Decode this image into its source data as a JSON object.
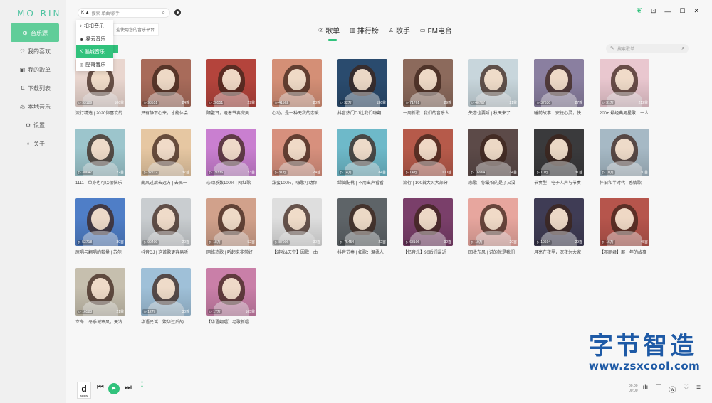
{
  "app": {
    "logo": "MO RIN"
  },
  "colors": {
    "accent": "#31c27c",
    "watermark": "#1e5aa6"
  },
  "sidebar": {
    "items": [
      {
        "icon": "music-source-icon",
        "glyph": "⊕",
        "label": "音乐源",
        "active": true
      },
      {
        "icon": "heart-icon",
        "glyph": "♡",
        "label": "我的喜欢"
      },
      {
        "icon": "playlist-icon",
        "glyph": "▣",
        "label": "我的歌单"
      },
      {
        "icon": "download-icon",
        "glyph": "⇅",
        "label": "下载列表"
      },
      {
        "icon": "local-music-icon",
        "glyph": "◎",
        "label": "本地音乐"
      },
      {
        "icon": "settings-icon",
        "glyph": "⚙",
        "label": "设置"
      },
      {
        "icon": "info-icon",
        "glyph": "♀",
        "label": "关于"
      }
    ]
  },
  "search": {
    "source_badge": "K ▲",
    "placeholder": "搜索 单曲/歌手"
  },
  "dropdown": {
    "items": [
      {
        "glyph": "♪",
        "label": "扣扣音乐"
      },
      {
        "glyph": "◉",
        "label": "易云音乐"
      },
      {
        "glyph": "K",
        "label": "酷城音乐",
        "selected": true
      },
      {
        "glyph": "◎",
        "label": "酷哥音乐"
      }
    ],
    "hint": "迎使用您的音乐平台"
  },
  "tabs": [
    {
      "glyph": "②",
      "label": "歌单",
      "active": true
    },
    {
      "glyph": "▥",
      "label": "排行榜"
    },
    {
      "glyph": "♙",
      "label": "歌手"
    },
    {
      "glyph": "▭",
      "label": "FM电台"
    }
  ],
  "list_search": {
    "placeholder": "搜索歌单"
  },
  "playlists": [
    {
      "plays": "93189",
      "songs": "106首",
      "title": "流行精选 | 2020你喜欢的",
      "bg": "#e9d6cf"
    },
    {
      "plays": "93551",
      "songs": "24首",
      "title": "只有静下心来，才能体会",
      "bg": "#a86b5a"
    },
    {
      "plays": "20551",
      "songs": "29首",
      "title": "隔壁耳，退着节奏完美",
      "bg": "#b4443c"
    },
    {
      "plays": "41562",
      "songs": "20首",
      "title": "心动，是一种无我的恋爱",
      "bg": "#d48f76"
    },
    {
      "plays": "32万",
      "songs": "136首",
      "title": "抖音热门DJ让我们嗨翻",
      "bg": "#2a4b6e"
    },
    {
      "plays": "71761",
      "songs": "29首",
      "title": "一周新歌 | 我们的音乐人",
      "bg": "#8c6a5c"
    },
    {
      "plays": "48767",
      "songs": "21首",
      "title": "失恋也要听 | 秋天来了",
      "bg": "#c8d6dc"
    },
    {
      "plays": "37330",
      "songs": "27首",
      "title": "睡前故事：安抚心灵，快",
      "bg": "#8a7fa0"
    },
    {
      "plays": "31万",
      "songs": "212首",
      "title": "200+ 最经典男星歌：一人",
      "bg": "#e9c7cf"
    },
    {
      "plays": "30647",
      "songs": "22首",
      "title": "1111 · 单身也可以很快乐",
      "bg": "#9cc5cc"
    },
    {
      "plays": "32212",
      "songs": "37首",
      "title": "南风过后去远方 | 去民一",
      "bg": "#e6c7a2"
    },
    {
      "plays": "19336",
      "songs": "23首",
      "title": "心动系数100% | 网红歌",
      "bg": "#c97fd0"
    },
    {
      "plays": "31万",
      "songs": "24首",
      "title": "甜蜜100%，嗨歌打动你",
      "bg": "#d7907d"
    },
    {
      "plays": "14万",
      "songs": "84首",
      "title": "绿仙配桃 | 不用出声看看",
      "bg": "#6eb9c9"
    },
    {
      "plays": "14万",
      "songs": "100首",
      "title": "流行 | 100首大火大部分",
      "bg": "#b65a4a"
    },
    {
      "plays": "16964",
      "songs": "34首",
      "title": "悲歌，你最怕的是了又没",
      "bg": "#5c4a48"
    },
    {
      "plays": "10万",
      "songs": "31首",
      "title": "节奏型：电子人声与节奏",
      "bg": "#3a3a3c"
    },
    {
      "plays": "10万",
      "songs": "30首",
      "title": "怀旧和半时代 | 感情歌",
      "bg": "#a6b9c5"
    },
    {
      "plays": "53718",
      "songs": "30首",
      "title": "原唱与翻唱的较量 | 苏尔",
      "bg": "#4f7ec7"
    },
    {
      "plays": "90409",
      "songs": "20首",
      "title": "抖音DJ | 这首歌更容易听",
      "bg": "#c9cdd0"
    },
    {
      "plays": "18万",
      "songs": "52首",
      "title": "网络热歌 | 听起来非常好",
      "bg": "#d1a18b"
    },
    {
      "plays": "87006",
      "songs": "30首",
      "title": "【游戏&天空】因歌一曲",
      "bg": "#dedede"
    },
    {
      "plays": "75454",
      "songs": "22首",
      "title": "抖音节奏 | 如歌：温柔人",
      "bg": "#5e6468"
    },
    {
      "plays": "68106",
      "songs": "92首",
      "title": "【亿音乐】90后们最近",
      "bg": "#7a3f6a"
    },
    {
      "plays": "10万",
      "songs": "20首",
      "title": "回收东风 | 说的就是我们",
      "bg": "#e7a69e"
    },
    {
      "plays": "10604",
      "songs": "29首",
      "title": "月亮在夜里，深夜为大家",
      "bg": "#3f3c55"
    },
    {
      "plays": "16万",
      "songs": "45首",
      "title": "【邓丽君】那一年的故事",
      "bg": "#b6554c"
    },
    {
      "plays": "16588",
      "songs": "21首",
      "title": "立冬：冬季城市风，天冷",
      "bg": "#c6bfae"
    },
    {
      "plays": "12万",
      "songs": "30首",
      "title": "华语民谣：繁华过后的",
      "bg": "#9fc0d8"
    },
    {
      "plays": "17万",
      "songs": "165首",
      "title": "【华语翻唱】老歌新唱",
      "bg": "#c97fa8"
    }
  ],
  "player": {
    "disc_letter": "d",
    "disc_label": "MORIN",
    "time_current": "00:00",
    "time_total": "00:00"
  },
  "watermark": {
    "title": "字节智造",
    "url": "www.zsxcool.com"
  }
}
